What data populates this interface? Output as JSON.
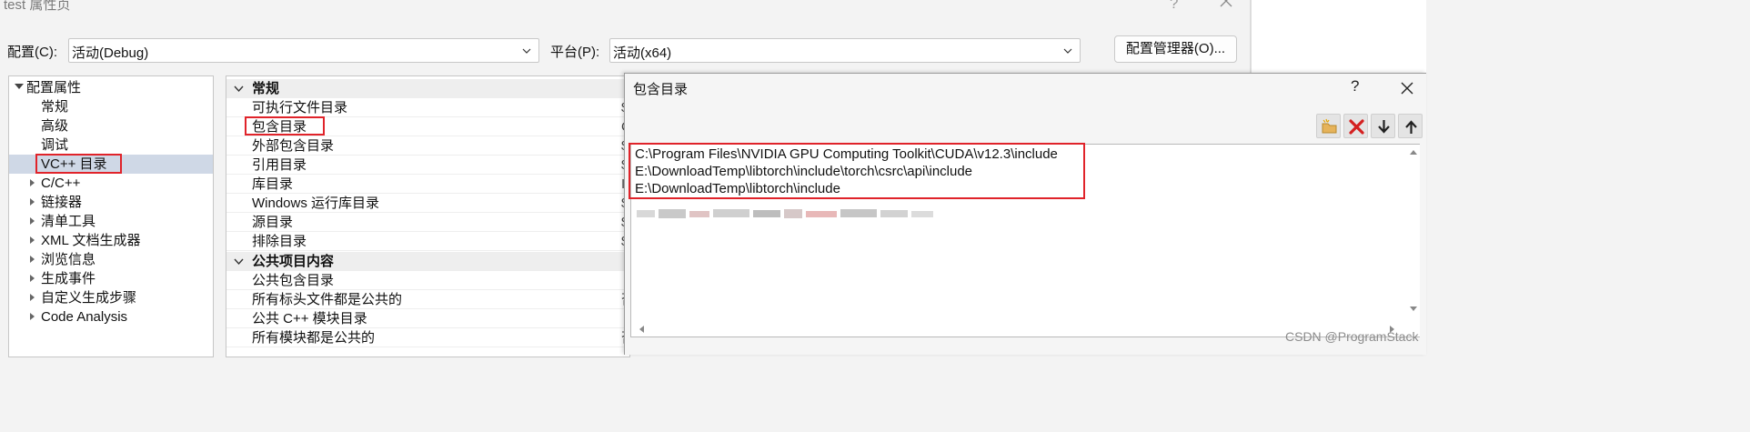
{
  "window": {
    "title": "test 属性页",
    "help": "?"
  },
  "config": {
    "config_label": "配置(C):",
    "config_value": "活动(Debug)",
    "platform_label": "平台(P):",
    "platform_value": "活动(x64)",
    "manager_button": "配置管理器(O)..."
  },
  "tree": {
    "root": "配置属性",
    "items": [
      "常规",
      "高级",
      "调试",
      "VC++ 目录",
      "C/C++",
      "链接器",
      "清单工具",
      "XML 文档生成器",
      "浏览信息",
      "生成事件",
      "自定义生成步骤",
      "Code Analysis"
    ],
    "selected": "VC++ 目录"
  },
  "grid": {
    "category1": "常规",
    "rows1": [
      "可执行文件目录",
      "包含目录",
      "外部包含目录",
      "引用目录",
      "库目录",
      "Windows 运行库目录",
      "源目录",
      "排除目录"
    ],
    "category2": "公共项目内容",
    "rows2": [
      "公共包含目录",
      "所有标头文件都是公共的",
      "公共 C++ 模块目录",
      "所有模块都是公共的"
    ],
    "values": [
      "$",
      "C",
      "$",
      "$",
      "I",
      "$",
      "$",
      "$",
      "",
      "",
      "否",
      "",
      "否"
    ]
  },
  "dialog": {
    "title": "包含目录",
    "help": "?",
    "toolbar": [
      "new-folder-icon",
      "delete-icon",
      "move-down-icon",
      "move-up-icon"
    ],
    "paths": [
      "C:\\Program Files\\NVIDIA GPU Computing Toolkit\\CUDA\\v12.3\\include",
      "E:\\DownloadTemp\\libtorch\\include\\torch\\csrc\\api\\include",
      "E:\\DownloadTemp\\libtorch\\include"
    ]
  },
  "watermark": "CSDN @ProgramStack",
  "colors": {
    "highlight": "#e0232a",
    "selection": "#cfd8e6",
    "window_bg": "#f3f3f3"
  }
}
